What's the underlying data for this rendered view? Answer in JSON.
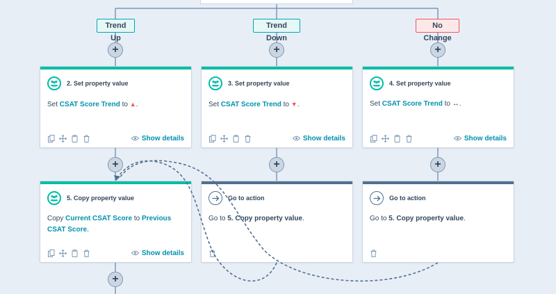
{
  "branches": {
    "up": "Trend Up",
    "down": "Trend Down",
    "no_change": "No Change"
  },
  "cards": {
    "c2": {
      "title": "2. Set property value",
      "prefix": "Set ",
      "property": "CSAT Score Trend",
      "middle": " to ",
      "value_symbol": "▲",
      "suffix": "."
    },
    "c3": {
      "title": "3. Set property value",
      "prefix": "Set ",
      "property": "CSAT Score Trend",
      "middle": " to ",
      "value_symbol": "▼",
      "suffix": "."
    },
    "c4": {
      "title": "4. Set property value",
      "prefix": "Set ",
      "property": "CSAT Score Trend",
      "middle": " to ",
      "value_symbol": "↔",
      "suffix": "."
    },
    "c5": {
      "title": "5. Copy property value",
      "prefix": "Copy ",
      "source": "Current CSAT Score",
      "middle": " to ",
      "target": "Previous CSAT Score",
      "suffix": "."
    },
    "goto_a": {
      "title": "Go to action",
      "prefix": "Go to ",
      "target": "5. Copy property value",
      "suffix": "."
    },
    "goto_b": {
      "title": "Go to action",
      "prefix": "Go to ",
      "target": "5. Copy property value",
      "suffix": "."
    }
  },
  "footer": {
    "show_details": "Show details"
  },
  "colors": {
    "teal": "#00bda5",
    "link": "#0091ae",
    "slate": "#516f90",
    "red": "#f2545b",
    "background": "#e8eef6"
  }
}
